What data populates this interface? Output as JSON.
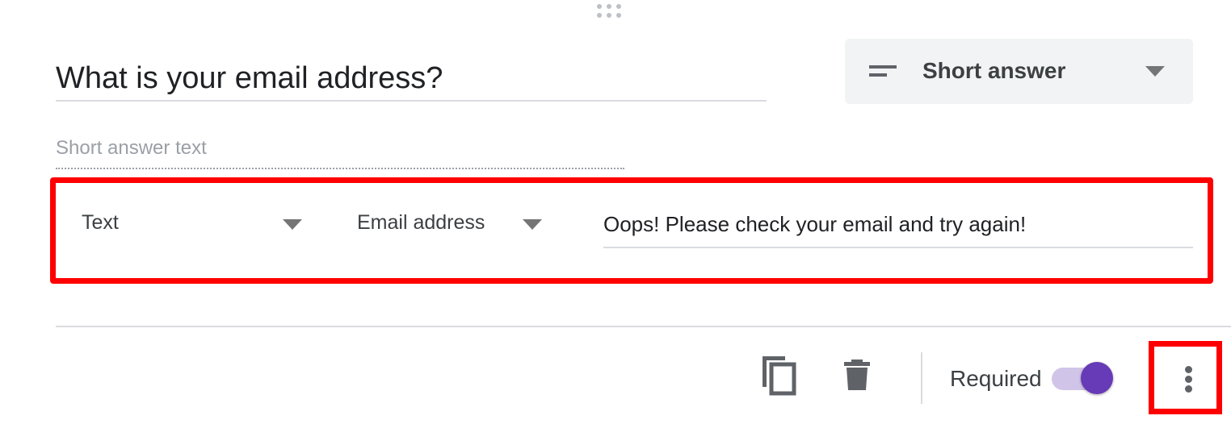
{
  "question": {
    "title": "What is your email address?",
    "type_label": "Short answer",
    "type_icon": "short-text-lines-icon",
    "answer_placeholder": "Short answer text"
  },
  "validation": {
    "type_value": "Text",
    "condition_value": "Email address",
    "error_text": "Oops! Please check your email and try again!"
  },
  "footer": {
    "copy_icon": "copy-icon",
    "delete_icon": "trash-icon",
    "required_label": "Required",
    "required_on": true,
    "more_icon": "more-vert-icon"
  },
  "colors": {
    "accent": "#673ab7",
    "toggle_track": "#d1c4e9",
    "highlight": "#ff0000",
    "select_bg": "#f1f3f4"
  }
}
